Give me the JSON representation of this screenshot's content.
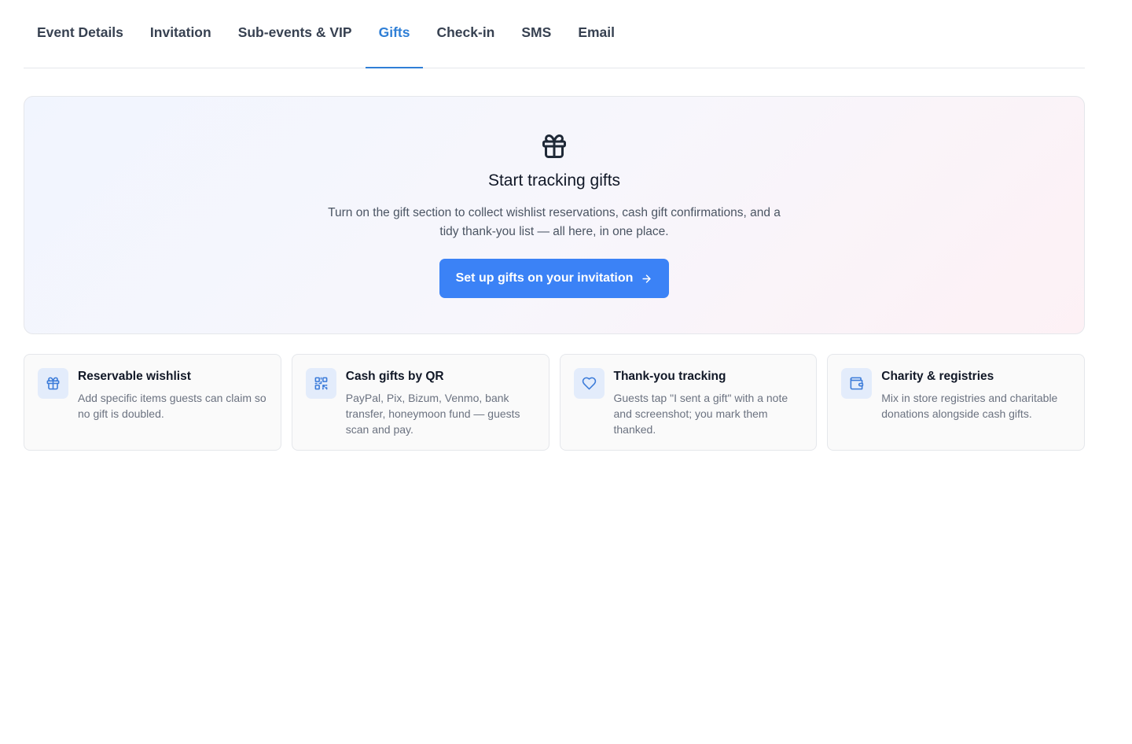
{
  "tabs": [
    {
      "label": "Event Details",
      "active": false
    },
    {
      "label": "Invitation",
      "active": false
    },
    {
      "label": "Sub-events & VIP",
      "active": false
    },
    {
      "label": "Gifts",
      "active": true
    },
    {
      "label": "Check-in",
      "active": false
    },
    {
      "label": "SMS",
      "active": false
    },
    {
      "label": "Email",
      "active": false
    }
  ],
  "hero": {
    "icon": "gift-icon",
    "title": "Start tracking gifts",
    "description": "Turn on the gift section to collect wishlist reservations, cash gift confirmations, and a tidy thank-you list — all here, in one place.",
    "button_label": "Set up gifts on your invitation",
    "button_icon": "arrow-right-icon"
  },
  "features": [
    {
      "icon": "gift-icon",
      "title": "Reservable wishlist",
      "description": "Add specific items guests can claim so no gift is doubled."
    },
    {
      "icon": "qr-code-icon",
      "title": "Cash gifts by QR",
      "description": "PayPal, Pix, Bizum, Venmo, bank transfer, honeymoon fund — guests scan and pay."
    },
    {
      "icon": "heart-icon",
      "title": "Thank-you tracking",
      "description": "Guests tap \"I sent a gift\" with a note and screenshot; you mark them thanked."
    },
    {
      "icon": "wallet-icon",
      "title": "Charity & registries",
      "description": "Mix in store registries and charitable donations alongside cash gifts."
    }
  ],
  "colors": {
    "accent": "#3b82f6",
    "active_tab": "#2f7fd6",
    "icon_blue": "#3b7bd9"
  }
}
